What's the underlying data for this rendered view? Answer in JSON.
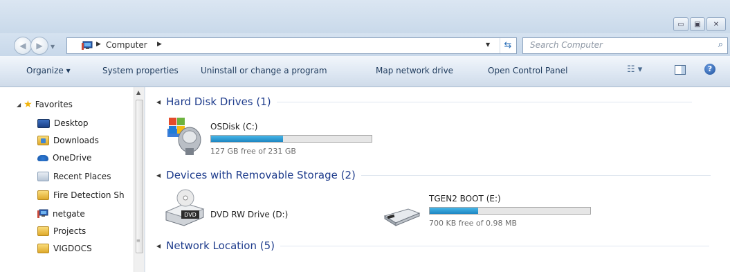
{
  "window": {
    "caption_buttons": [
      "minimize",
      "maximize",
      "close"
    ]
  },
  "address": {
    "path_item": "Computer",
    "search_placeholder": "Search Computer"
  },
  "toolbar": {
    "organize": "Organize ▾",
    "system_properties": "System properties",
    "uninstall": "Uninstall or change a program",
    "map_network": "Map network drive",
    "control_panel": "Open Control Panel"
  },
  "sidebar": {
    "favorites_label": "Favorites",
    "items": [
      {
        "label": "Desktop",
        "icon": "desktop-icon"
      },
      {
        "label": "Downloads",
        "icon": "downloads-folder-icon"
      },
      {
        "label": "OneDrive",
        "icon": "onedrive-icon"
      },
      {
        "label": "Recent Places",
        "icon": "recent-places-icon"
      },
      {
        "label": "Fire Detection Sh",
        "icon": "folder-icon"
      },
      {
        "label": "netgate",
        "icon": "network-computer-icon"
      },
      {
        "label": "Projects",
        "icon": "folder-icon"
      },
      {
        "label": "VIGDOCS",
        "icon": "folder-icon"
      }
    ]
  },
  "groups": {
    "hard_disk": {
      "title": "Hard Disk Drives (1)",
      "drive": {
        "name": "OSDisk (C:)",
        "free_text": "127 GB free of 231 GB",
        "used_fraction": 0.45
      }
    },
    "removable": {
      "title": "Devices with Removable Storage (2)",
      "dvd": {
        "name": "DVD RW Drive (D:)",
        "icon_text": "DVD"
      },
      "usb": {
        "name": "TGEN2 BOOT (E:)",
        "free_text": "700 KB free of 0.98 MB",
        "used_fraction": 0.3
      }
    },
    "network": {
      "title": "Network Location (5)"
    }
  },
  "colors": {
    "group_header": "#1e3c8c",
    "capacity_bar": "#2a95d0",
    "link_text": "#1e3a5c"
  }
}
